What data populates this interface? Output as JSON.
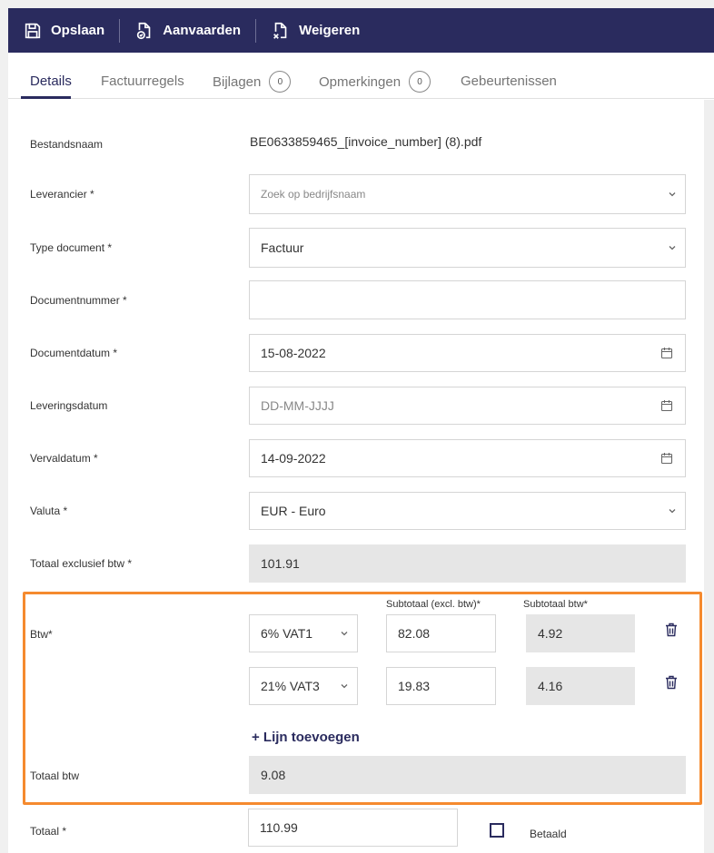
{
  "toolbar": {
    "save_label": "Opslaan",
    "accept_label": "Aanvaarden",
    "reject_label": "Weigeren"
  },
  "tabs": [
    {
      "label": "Details",
      "active": true
    },
    {
      "label": "Factuurregels"
    },
    {
      "label": "Bijlagen",
      "count": "0"
    },
    {
      "label": "Opmerkingen",
      "count": "0"
    },
    {
      "label": "Gebeurtenissen"
    }
  ],
  "form": {
    "filename_label": "Bestandsnaam",
    "filename_value": "BE0633859465_[invoice_number] (8).pdf",
    "supplier_label": "Leverancier *",
    "supplier_placeholder": "Zoek op bedrijfsnaam",
    "doctype_label": "Type document *",
    "doctype_value": "Factuur",
    "docnumber_label": "Documentnummer *",
    "docnumber_value": "",
    "docdate_label": "Documentdatum *",
    "docdate_value": "15-08-2022",
    "deliverydate_label": "Leveringsdatum",
    "deliverydate_placeholder": "DD-MM-JJJJ",
    "duedate_label": "Vervaldatum *",
    "duedate_value": "14-09-2022",
    "currency_label": "Valuta *",
    "currency_value": "EUR - Euro",
    "total_excl_label": "Totaal exclusief btw *",
    "total_excl_value": "101.91"
  },
  "vat": {
    "label": "Btw*",
    "subtotal_excl_header": "Subtotaal (excl. btw)*",
    "subtotal_vat_header": "Subtotaal btw*",
    "lines": [
      {
        "rate": "6% VAT1",
        "subtotal_excl": "82.08",
        "subtotal_vat": "4.92"
      },
      {
        "rate": "21% VAT3",
        "subtotal_excl": "19.83",
        "subtotal_vat": "4.16"
      }
    ],
    "add_line_label": "+ Lijn toevoegen",
    "total_label": "Totaal btw",
    "total_value": "9.08"
  },
  "total": {
    "label": "Totaal *",
    "value": "110.99",
    "paid_label": "Betaald",
    "paid_checked": false
  },
  "colors": {
    "primary": "#2a2b5e",
    "highlight": "#f58a2e",
    "readonly_bg": "#e6e6e6"
  },
  "icons": {
    "save": "floppy-disk-icon",
    "accept": "document-accept-icon",
    "reject": "document-reject-icon",
    "dropdown": "chevron-down-icon",
    "date": "calendar-icon",
    "delete": "trash-icon"
  }
}
